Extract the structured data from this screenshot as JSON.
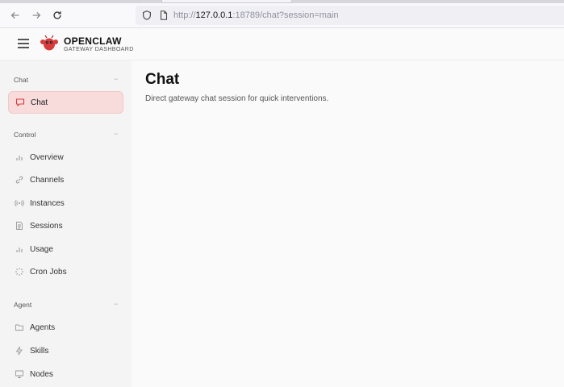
{
  "browser": {
    "url_prefix": "http://",
    "url_host": "127.0.0.1",
    "url_rest": ":18789/chat?session=main"
  },
  "app": {
    "title": "OPENCLAW",
    "subtitle": "GATEWAY DASHBOARD",
    "accent": "#d93b3b"
  },
  "sidebar": {
    "groups": [
      {
        "label": "Chat",
        "collapse": "−",
        "items": [
          {
            "label": "Chat",
            "icon": "message-icon",
            "active": true
          }
        ]
      },
      {
        "label": "Control",
        "collapse": "−",
        "items": [
          {
            "label": "Overview",
            "icon": "bar-chart-icon"
          },
          {
            "label": "Channels",
            "icon": "link-icon"
          },
          {
            "label": "Instances",
            "icon": "radio-icon"
          },
          {
            "label": "Sessions",
            "icon": "document-icon"
          },
          {
            "label": "Usage",
            "icon": "bar-chart-icon"
          },
          {
            "label": "Cron Jobs",
            "icon": "loader-icon"
          }
        ]
      },
      {
        "label": "Agent",
        "collapse": "−",
        "items": [
          {
            "label": "Agents",
            "icon": "folder-icon"
          },
          {
            "label": "Skills",
            "icon": "zap-icon"
          },
          {
            "label": "Nodes",
            "icon": "monitor-icon"
          }
        ]
      }
    ]
  },
  "main": {
    "title": "Chat",
    "description": "Direct gateway chat session for quick interventions."
  }
}
